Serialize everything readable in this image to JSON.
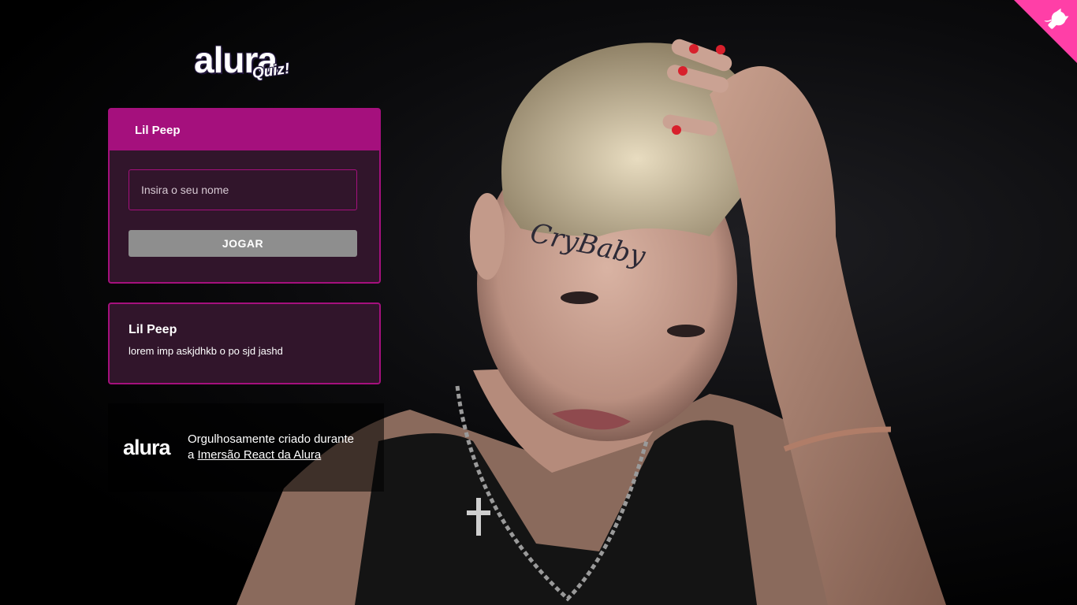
{
  "logo": {
    "word": "alura",
    "tag": "Quiz!"
  },
  "quiz_widget": {
    "title": "Lil Peep",
    "name_placeholder": "Insira o seu nome",
    "play_label": "JOGAR"
  },
  "info_widget": {
    "title": "Lil Peep",
    "text": "lorem imp askjdhkb o po sjd jashd"
  },
  "footer": {
    "logo": "alura",
    "text_line1": "Orgulhosamente criado durante",
    "text_prefix": "a ",
    "link_label": "Imersão React da Alura"
  },
  "colors": {
    "primary": "#a5107d",
    "widget_bg": "#34162d",
    "button_disabled": "#8e8e8e",
    "corner": "#ff3fa7"
  },
  "icons": {
    "github_corner": "octocat-icon"
  }
}
